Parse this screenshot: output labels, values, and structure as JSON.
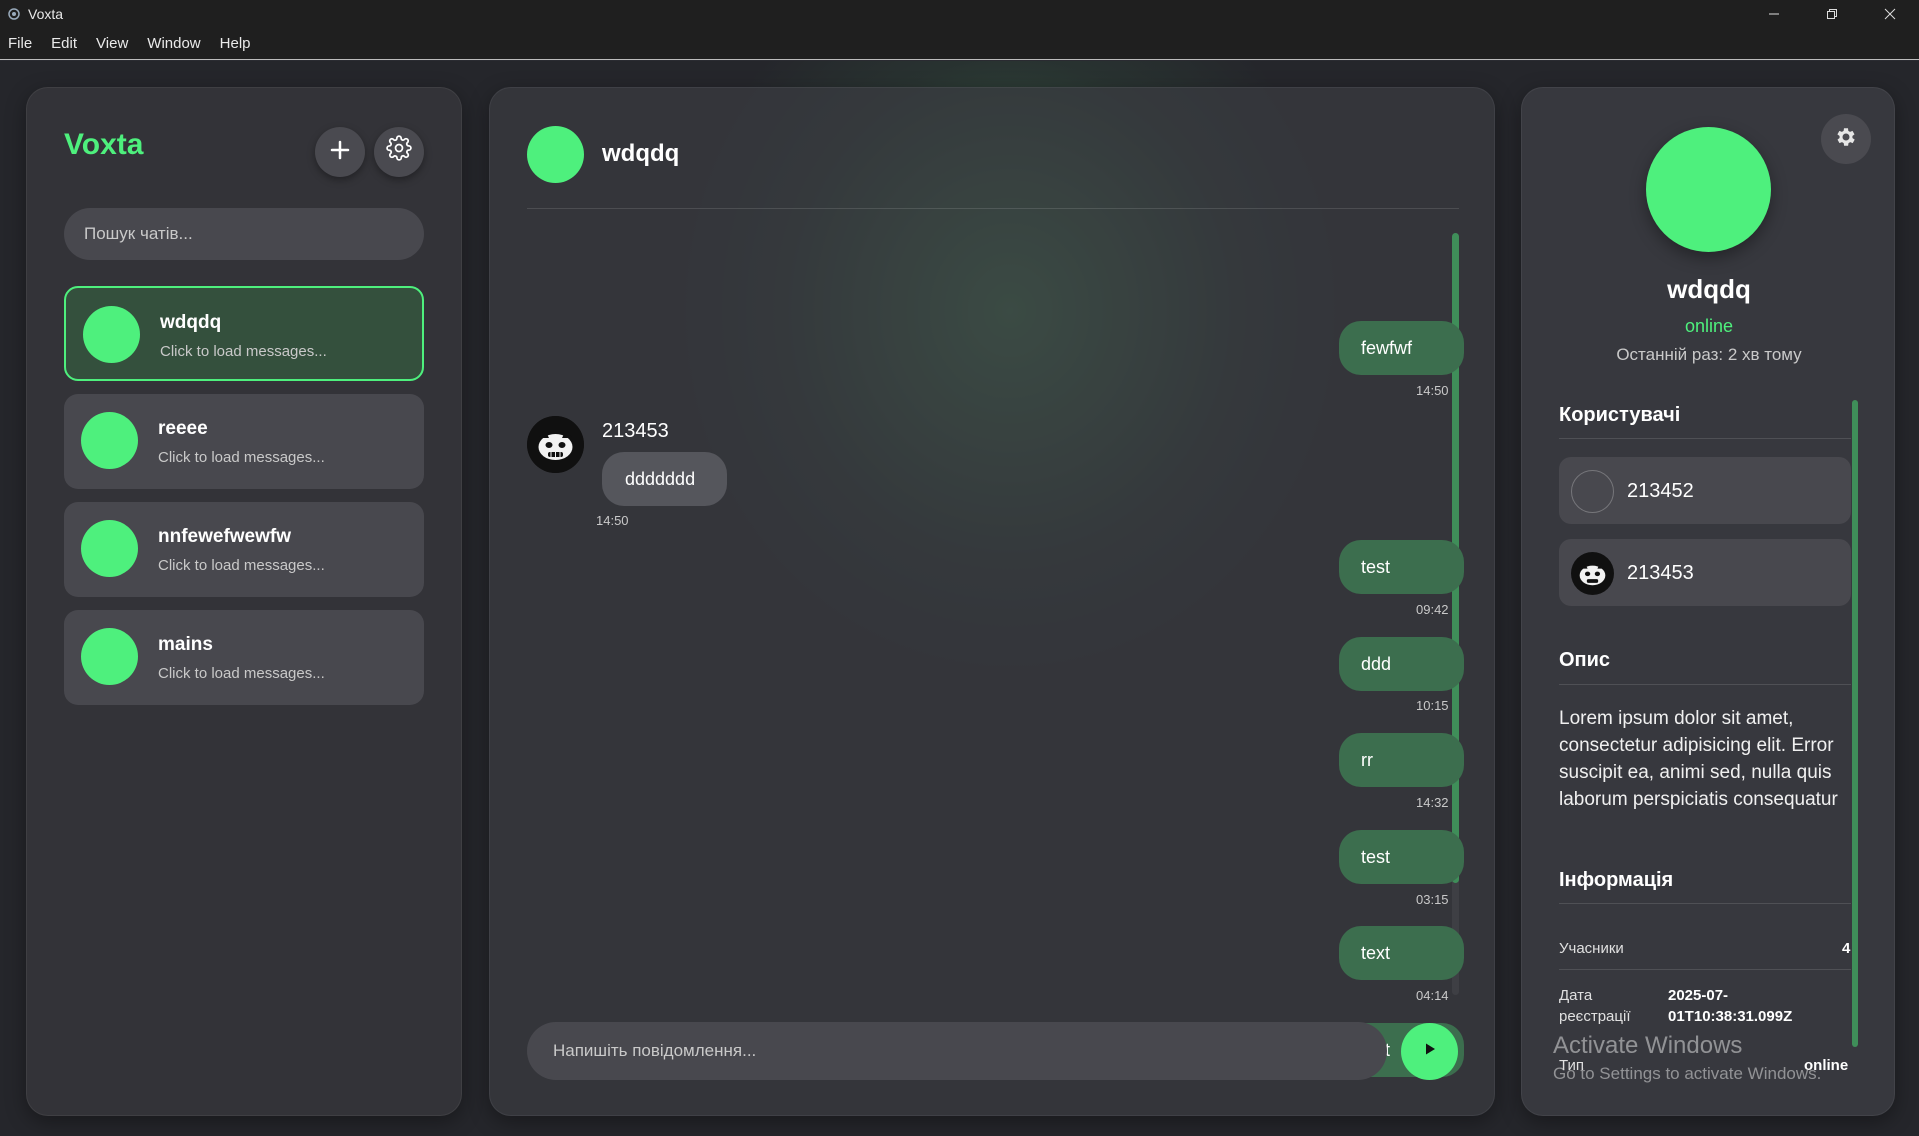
{
  "window": {
    "title": "Voxta"
  },
  "menu": [
    "File",
    "Edit",
    "View",
    "Window",
    "Help"
  ],
  "sidebar": {
    "brand": "Voxta",
    "search_placeholder": "Пошук чатів...",
    "chats": [
      {
        "name": "wdqdq",
        "preview": "Click to load messages...",
        "active": true
      },
      {
        "name": "reeee",
        "preview": "Click to load messages...",
        "active": false
      },
      {
        "name": "nnfewefwewfw",
        "preview": "Click to load messages...",
        "active": false
      },
      {
        "name": "mains",
        "preview": "Click to load messages...",
        "active": false
      }
    ]
  },
  "chat": {
    "title": "wdqdq",
    "messages": [
      {
        "text": "fewfwf",
        "time": "14:50"
      },
      {
        "sender": "213453",
        "text": "ddddddd",
        "time": "14:50"
      },
      {
        "text": "test",
        "time": "09:42"
      },
      {
        "text": "ddd",
        "time": "10:15"
      },
      {
        "text": "rr",
        "time": "14:32"
      },
      {
        "text": "test",
        "time": "03:15"
      },
      {
        "text": "text",
        "time": "04:14"
      },
      {
        "text": "test",
        "time": ""
      }
    ],
    "composer_placeholder": "Напишіть повідомлення..."
  },
  "profile": {
    "name": "wdqdq",
    "status": "online",
    "last_seen": "Останній раз: 2 хв тому",
    "users_title": "Користувачі",
    "users": [
      "213452",
      "213453"
    ],
    "description_title": "Опис",
    "description": "Lorem ipsum dolor sit amet, consectetur adipisicing elit. Error suscipit ea, animi sed, nulla quis laborum perspiciatis consequatur",
    "info_title": "Інформація",
    "info": {
      "members_label": "Учасники",
      "members_value": "4",
      "date_label_1": "Дата",
      "date_label_2": "реєстрації",
      "date_value_1": "2025-07-",
      "date_value_2": "01T10:38:31.099Z",
      "type_label": "Тип",
      "type_value": "online"
    }
  },
  "watermark": {
    "line1": "Activate Windows",
    "line2": "Go to Settings to activate Windows."
  },
  "colors": {
    "accent": "#4ef07d",
    "bubble_out": "#3c6e4e",
    "panel": "#333338"
  }
}
